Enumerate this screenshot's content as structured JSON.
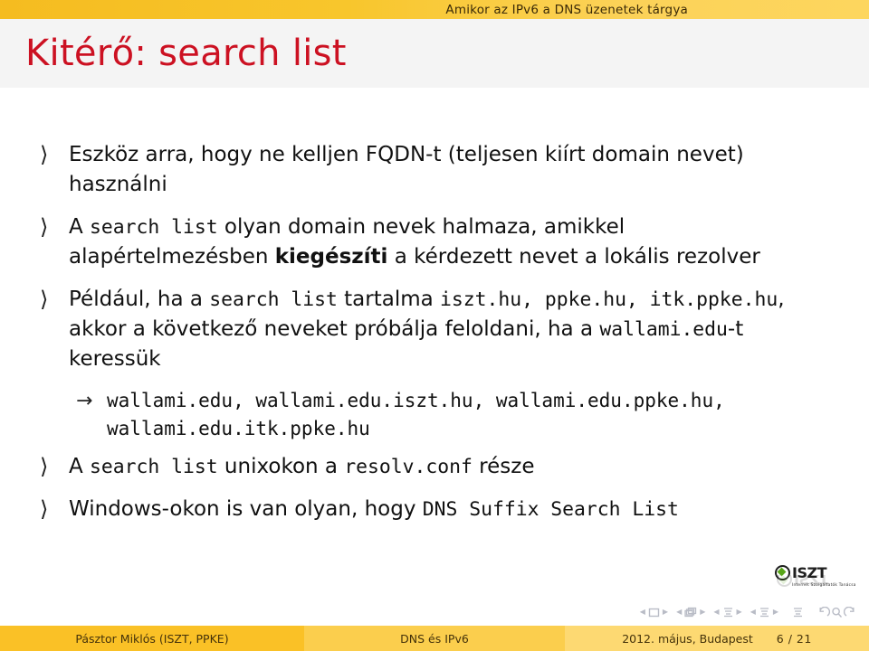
{
  "headbar": {
    "section_title": "Amikor az IPv6 a DNS üzenetek tárgya"
  },
  "slide": {
    "title": "Kitérő: search list"
  },
  "bullets": [
    {
      "marker": "⟩",
      "parts": [
        {
          "text": "Eszköz arra, hogy ne kelljen FQDN-t (teljesen kiírt domain nevet) használni",
          "style": "normal"
        }
      ]
    },
    {
      "marker": "⟩",
      "parts": [
        {
          "text": "A ",
          "style": "normal"
        },
        {
          "text": "search list",
          "style": "mono"
        },
        {
          "text": " olyan domain nevek halmaza, amikkel alapértelmezésben ",
          "style": "normal"
        },
        {
          "text": "kiegészíti",
          "style": "bold"
        },
        {
          "text": " a kérdezett nevet a lokális rezolver",
          "style": "normal"
        }
      ]
    },
    {
      "marker": "⟩",
      "parts": [
        {
          "text": "Például, ha a ",
          "style": "normal"
        },
        {
          "text": "search list",
          "style": "mono"
        },
        {
          "text": " tartalma ",
          "style": "normal"
        },
        {
          "text": "iszt.hu, ppke.hu, itk.ppke.hu",
          "style": "mono"
        },
        {
          "text": ", akkor a következő neveket próbálja feloldani, ha a ",
          "style": "normal"
        },
        {
          "text": "wallami.edu",
          "style": "mono"
        },
        {
          "text": "-t keressük",
          "style": "normal"
        }
      ]
    }
  ],
  "subitem": {
    "marker": "→",
    "text": "wallami.edu, wallami.edu.iszt.hu, wallami.edu.ppke.hu, wallami.edu.itk.ppke.hu"
  },
  "bullets_tail": [
    {
      "marker": "⟩",
      "parts": [
        {
          "text": "A ",
          "style": "normal"
        },
        {
          "text": "search list",
          "style": "mono"
        },
        {
          "text": " unixokon a ",
          "style": "normal"
        },
        {
          "text": "resolv.conf",
          "style": "mono"
        },
        {
          "text": " része",
          "style": "normal"
        }
      ]
    },
    {
      "marker": "⟩",
      "parts": [
        {
          "text": "Windows-okon is van olyan, hogy ",
          "style": "normal"
        },
        {
          "text": "DNS Suffix Search List",
          "style": "mono"
        }
      ]
    }
  ],
  "logo": {
    "word": "ISZT",
    "tagline": "Internet Szolgáltatók Tanácsa"
  },
  "footer": {
    "author": "Pásztor Miklós  (ISZT, PPKE)",
    "subject": "DNS és IPv6",
    "event": "2012. május, Budapest",
    "page": "6 / 21"
  },
  "colors": {
    "headbar_left": "#f5bc20",
    "headbar_right": "#fdd65e",
    "title_color": "#cc1122",
    "title_band": "#f4f4f4",
    "footer_left": "#fac126",
    "footer_mid": "#fbce4d",
    "footer_right": "#fdd972",
    "logo_green": "#58a618"
  }
}
